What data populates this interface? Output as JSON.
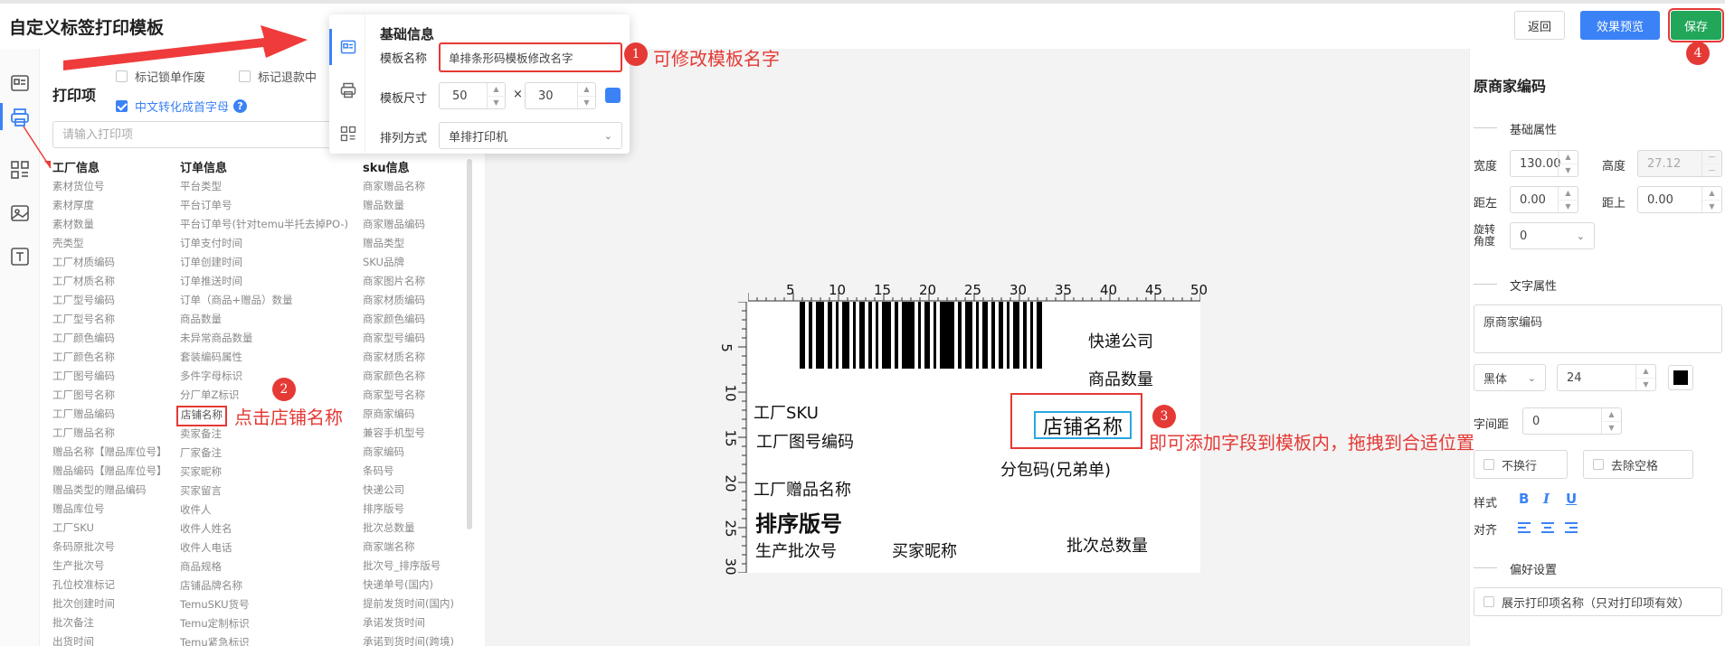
{
  "app": {
    "title": "自定义标签打印模板"
  },
  "header": {
    "back_label": "返回",
    "preview_label": "效果预览",
    "save_label": "保存"
  },
  "print_panel": {
    "title": "打印项",
    "options": [
      {
        "label": "标记锁单作废",
        "checked": false
      },
      {
        "label": "标记退款中",
        "checked": false
      },
      {
        "label": "中文转化成首字母",
        "checked": true
      }
    ],
    "help_glyph": "?",
    "search_placeholder": "请输入打印项",
    "columns": [
      {
        "header": "工厂信息",
        "items": [
          "素材货位号",
          "素材厚度",
          "素材数量",
          "壳类型",
          "工厂材质编码",
          "工厂材质名称",
          "工厂型号编码",
          "工厂型号名称",
          "工厂颜色编码",
          "工厂颜色名称",
          "工厂图号编码",
          "工厂图号名称",
          "工厂赠品编码",
          "工厂赠品名称",
          "赠品名称【赠品库位号】",
          "赠品编码【赠品库位号】",
          "赠品类型的赠品编码",
          "赠品库位号",
          "工厂SKU",
          "条码原批次号",
          "生产批次号",
          "孔位校准标记",
          "批次创建时间",
          "批次备注",
          "出货时间"
        ]
      },
      {
        "header": "订单信息",
        "items": [
          "平台类型",
          "平台订单号",
          "平台订单号(针对temu半托去掉PO-)",
          "订单支付时间",
          "订单创建时间",
          "订单推送时间",
          "订单（商品+赠品）数量",
          "商品数量",
          "未异常商品数量",
          "套装编码属性",
          "多件字母标识",
          "分厂单Z标识",
          "店铺名称",
          "卖家备注",
          "厂家备注",
          "买家昵称",
          "买家留言",
          "收件人",
          "收件人姓名",
          "收件人电话",
          "商品规格",
          "店铺品牌名称",
          "TemuSKU货号",
          "Temu定制标识",
          "Temu紧急标识"
        ]
      },
      {
        "header": "sku信息",
        "items": [
          "商家赠品名称",
          "赠品数量",
          "商家赠品编码",
          "赠品类型",
          "SKU品牌",
          "商家图片名称",
          "商家材质编码",
          "商家颜色编码",
          "商家型号编码",
          "商家材质名称",
          "商家颜色名称",
          "商家型号名称",
          "原商家编码",
          "兼容手机型号",
          "商家编码",
          "条码号",
          "快递公司",
          "排序版号",
          "批次总数量",
          "商家端名称",
          "批次号_排序版号",
          "快递单号(国内)",
          "提前发货时间(国内)",
          "承诺发货时间",
          "承诺到货时间(跨境)"
        ]
      }
    ]
  },
  "base_info": {
    "title": "基础信息",
    "name_label": "模板名称",
    "name_value": "单排条形码模板修改名字",
    "size_label": "模板尺寸",
    "width": "50",
    "height": "30",
    "times": "×",
    "color": "#3b82f6",
    "layout_label": "排列方式",
    "layout_value": "单排打印机"
  },
  "annotations": {
    "step1": {
      "num": "1",
      "text": "可修改模板名字"
    },
    "step2": {
      "num": "2",
      "text": "点击店铺名称"
    },
    "step3": {
      "num": "3",
      "text": "即可添加字段到模板内，拖拽到合适位置"
    },
    "step4": {
      "num": "4"
    }
  },
  "ruler": {
    "top_ticks": [
      "5",
      "10",
      "15",
      "20",
      "25",
      "30",
      "35",
      "40",
      "45",
      "50"
    ],
    "left_ticks": [
      "5",
      "10",
      "15",
      "20",
      "25",
      "30"
    ]
  },
  "template_fields": {
    "express_company": "快递公司",
    "goods_qty": "商品数量",
    "factory_sku": "工厂SKU",
    "factory_drawing_code": "工厂图号编码",
    "store_name": "店铺名称",
    "sub_package_code": "分包码(兄弟单)",
    "factory_gift_name": "工厂赠品名称",
    "sort_version": "排序版号",
    "production_batch": "生产批次号",
    "buyer_nick": "买家昵称",
    "batch_total_qty": "批次总数量"
  },
  "props": {
    "title": "原商家编码",
    "basic_section": "基础属性",
    "width_label": "宽度",
    "width_value": "130.00",
    "height_label": "高度",
    "height_value": "27.12",
    "left_label": "距左",
    "left_value": "0.00",
    "top_label": "距上",
    "top_value": "0.00",
    "rotate_label": "旋转角度",
    "rotate_value": "0",
    "text_section": "文字属性",
    "text_value": "原商家编码",
    "font_value": "黑体",
    "font_size": "24",
    "letter_spacing_label": "字间距",
    "letter_spacing_value": "0",
    "no_wrap_label": "不换行",
    "trim_label": "去除空格",
    "style_label": "样式",
    "style_b": "B",
    "style_i": "I",
    "style_u": "U",
    "align_label": "对齐",
    "pref_section": "偏好设置",
    "show_name_label": "展示打印项名称（只对打印项有效）"
  }
}
